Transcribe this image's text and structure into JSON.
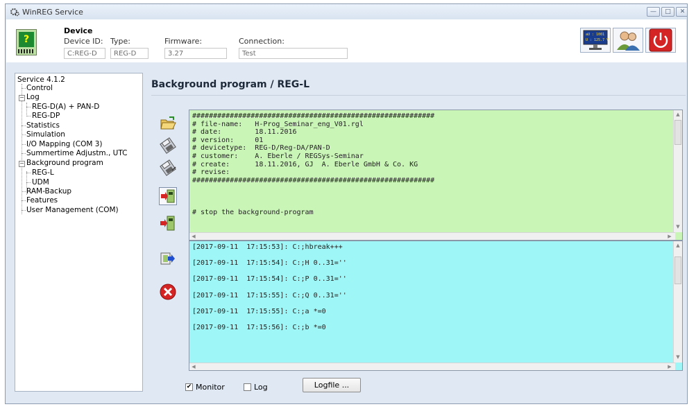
{
  "window": {
    "title": "WinREG Service",
    "controls": {
      "minimize": "—",
      "maximize": "□",
      "close": "✕"
    }
  },
  "header": {
    "section": "Device",
    "device_id_label": "Device ID:",
    "device_id_value": "C:REG-D",
    "type_label": "Type:",
    "type_value": "REG-D",
    "firmware_label": "Firmware:",
    "firmware_value": "3.27",
    "connection_label": "Connection:",
    "connection_value": "Test",
    "monitor_lines": [
      "aU : 1001",
      "U : 125.7 V"
    ]
  },
  "tree": {
    "items": [
      {
        "label": "Service 4.1.2"
      },
      {
        "label": "Control"
      },
      {
        "label": "Log"
      },
      {
        "label": "REG-D(A) + PAN-D"
      },
      {
        "label": "REG-DP"
      },
      {
        "label": "Statistics"
      },
      {
        "label": "Simulation"
      },
      {
        "label": "I/O Mapping (COM 3)"
      },
      {
        "label": "Summertime Adjustm., UTC"
      },
      {
        "label": "Background program"
      },
      {
        "label": "REG-L"
      },
      {
        "label": "UDM"
      },
      {
        "label": "RAM-Backup"
      },
      {
        "label": "Features"
      },
      {
        "label": "User Management (COM)"
      }
    ]
  },
  "main": {
    "title": "Background program / REG-L",
    "program_text": "##########################################################\n# file-name:   H-Prog_Seminar_eng_V01.rgl\n# date:        18.11.2016\n# version:     01\n# devicetype:  REG-D/Reg-DA/PAN-D\n# customer:    A. Eberle / REGSys-Seminar\n# create:      18.11.2016, GJ  A. Eberle GmbH & Co. KG\n# revise:\n##########################################################\n\n\n\n# stop the background-program",
    "log_text": "[2017-09-11  17:15:53]: C:;hbreak+++\n\n[2017-09-11  17:15:54]: C:;H 0..31=''\n\n[2017-09-11  17:15:54]: C:;P 0..31=''\n\n[2017-09-11  17:15:55]: C:;Q 0..31=''\n\n[2017-09-11  17:15:55]: C:;a *=0\n\n[2017-09-11  17:15:56]: C:;b *=0"
  },
  "bottom": {
    "monitor_label": "Monitor",
    "monitor_checked": true,
    "log_label": "Log",
    "log_checked": false,
    "logfile_button": "Logfile ..."
  },
  "colors": {
    "program_bg": "#c9f5b6",
    "log_bg": "#9ef7f6",
    "power_red": "#d42424",
    "window_bg": "#dfe8f3"
  }
}
